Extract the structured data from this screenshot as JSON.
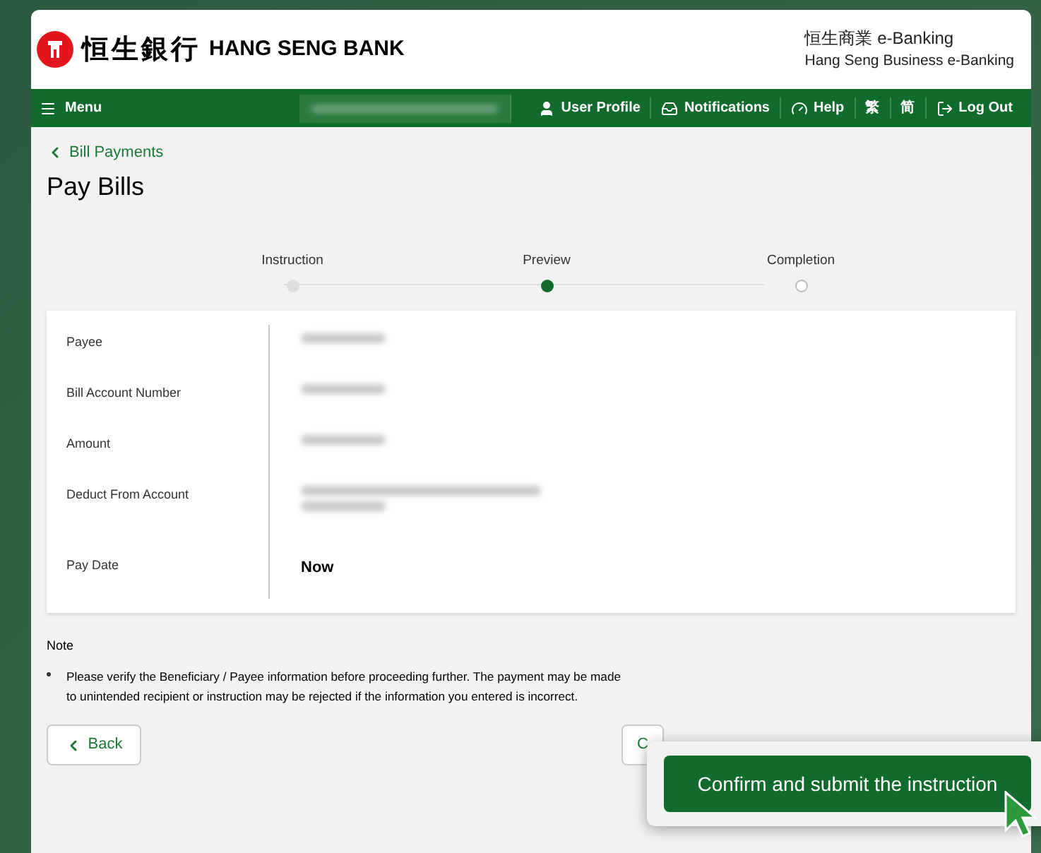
{
  "header": {
    "bank_name_chinese": "恒生銀行",
    "bank_name": "HANG SENG BANK",
    "service_title": "恒生商業 e-Banking",
    "service_subtitle": "Hang Seng Business e-Banking"
  },
  "nav": {
    "menu": "Menu",
    "items": [
      {
        "kind": "user",
        "label": "User Profile"
      },
      {
        "kind": "bell",
        "label": "Notifications"
      },
      {
        "kind": "help",
        "label": "Help"
      },
      {
        "kind": "text",
        "label": "繁"
      },
      {
        "kind": "text",
        "label": "简"
      },
      {
        "kind": "logout",
        "label": "Log Out"
      }
    ]
  },
  "breadcrumb": "Bill Payments",
  "page_title": "Pay Bills",
  "steps": [
    {
      "label": "Instruction",
      "kind": "completed"
    },
    {
      "label": "Preview",
      "kind": "current"
    },
    {
      "label": "Completion",
      "kind": "pending"
    }
  ],
  "details": [
    {
      "label": "Payee",
      "kind": "blurred"
    },
    {
      "label": "Bill Account Number",
      "kind": "blurred"
    },
    {
      "label": "Amount",
      "kind": "blurred"
    },
    {
      "label": "Deduct From Account",
      "kind": "blurred_long"
    },
    {
      "label": "Pay Date",
      "kind": "text",
      "value": "Now"
    }
  ],
  "note": {
    "title": "Note",
    "bullets": [
      "Please verify the Beneficiary / Payee information before proceeding further. The payment may be made to unintended recipient or instruction may be rejected if the information you entered is incorrect."
    ]
  },
  "back_button": "Back",
  "covered_button": "C",
  "confirm_button": "Confirm and submit the instruction"
}
